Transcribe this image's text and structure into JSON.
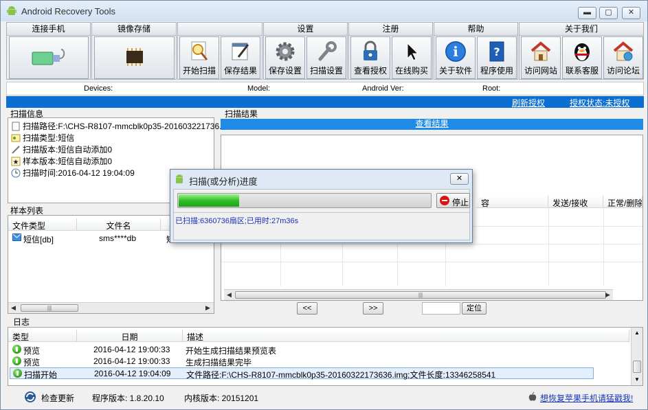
{
  "window": {
    "title": "Android Recovery Tools",
    "minimize": "▬",
    "maximize": "▢",
    "close": "✕"
  },
  "toolbar": {
    "groups": [
      {
        "name": "连接手机"
      },
      {
        "name": "镜像存储"
      },
      {
        "name": ""
      },
      {
        "name": "设置"
      },
      {
        "name": "注册"
      },
      {
        "name": "帮助"
      },
      {
        "name": "关于我们"
      }
    ],
    "buttons": {
      "start_scan": "开始扫描",
      "save_result": "保存结果",
      "save_settings": "保存设置",
      "scan_settings": "扫描设置",
      "view_license": "查看授权",
      "buy_online": "在线购买",
      "about_software": "关于软件",
      "program_help": "程序使用",
      "visit_site": "访问网站",
      "contact_support": "联系客服",
      "visit_forum": "访问论坛"
    }
  },
  "device_info": {
    "devices": "Devices:",
    "model": "Model:",
    "android_ver": "Android Ver:",
    "root": "Root:"
  },
  "license_bar": {
    "refresh": "刷新授权",
    "status": "授权状态:未授权"
  },
  "scan_info": {
    "label": "扫描信息",
    "rows": [
      "扫描路径:F:\\CHS-R8107-mmcblk0p35-201603221736...",
      "扫描类型:短信",
      "扫描版本:短信自动添加0",
      "样本版本:短信自动添加0",
      "扫描时间:2016-04-12 19:04:09"
    ]
  },
  "sample_list": {
    "label": "样本列表",
    "columns": [
      "文件类型",
      "文件名",
      ""
    ],
    "rows": [
      {
        "type": "短信[db]",
        "name": "sms****db",
        "extra": "短"
      }
    ]
  },
  "scan_results": {
    "label": "扫描结果",
    "view_link": "查看结果",
    "columns": [
      "容",
      "发送/接收",
      "正常/删除"
    ],
    "prev": "<<",
    "next": ">>",
    "goto": "定位"
  },
  "log": {
    "label": "日志",
    "columns": [
      "类型",
      "日期",
      "描述"
    ],
    "rows": [
      {
        "type": "预览",
        "date": "2016-04-12 19:00:33",
        "desc": "开始生成扫描结果预览表"
      },
      {
        "type": "预览",
        "date": "2016-04-12 19:00:33",
        "desc": "生成扫描结果完毕"
      },
      {
        "type": "扫描开始",
        "date": "2016-04-12 19:04:09",
        "desc": "文件路径:F:\\CHS-R8107-mmcblk0p35-20160322173636.img;文件长度:13346258541"
      }
    ]
  },
  "status_bar": {
    "check_update": "检查更新",
    "program_version": "程序版本: 1.8.20.10",
    "kernel_version": "内核版本: 20151201",
    "promo": "想恢复苹果手机请猛戳我!"
  },
  "dialog": {
    "title": "扫描(或分析)进度",
    "close": "✕",
    "stop": "停止",
    "progress": 0.24,
    "status": "已扫描:6360736扇区;已用时:27m36s"
  }
}
